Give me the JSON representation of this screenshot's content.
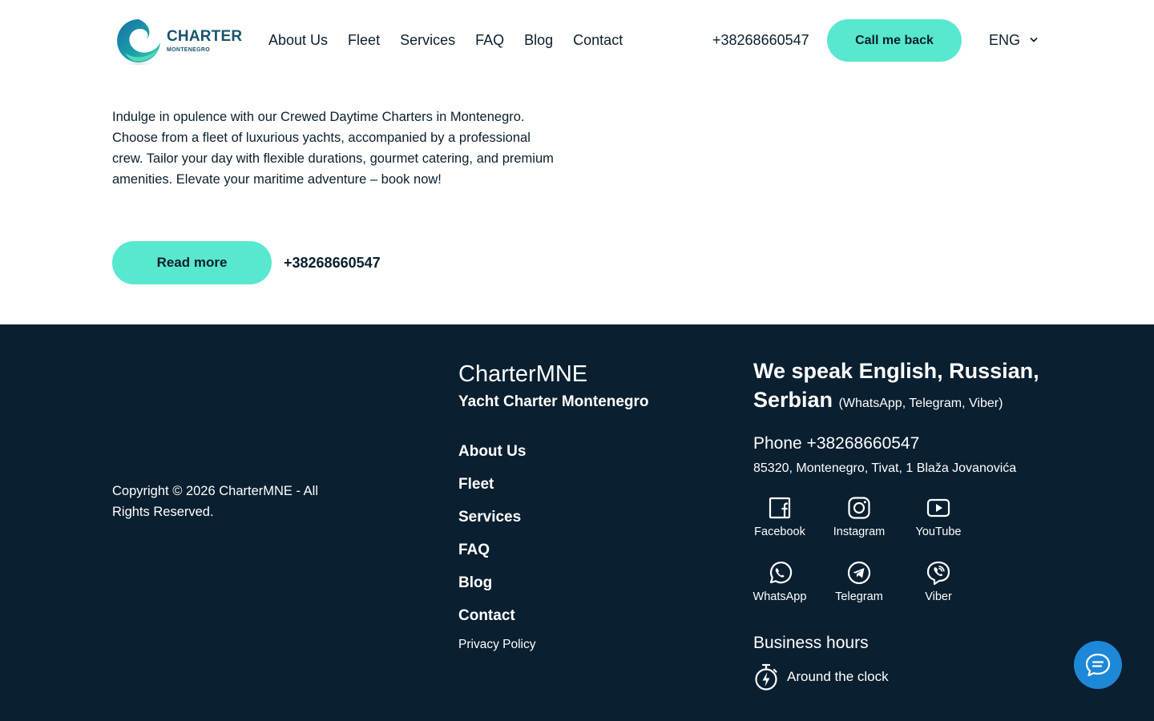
{
  "header": {
    "logo": {
      "title": "CHARTER",
      "subtitle": "MONTENEGRO"
    },
    "nav": [
      "About Us",
      "Fleet",
      "Services",
      "FAQ",
      "Blog",
      "Contact"
    ],
    "phone": "+38268660547",
    "callback_label": "Call me back",
    "language": "ENG"
  },
  "hero": {
    "description": "Indulge in opulence with our Crewed Daytime Charters in Montenegro. Choose from a fleet of luxurious yachts, accompanied by a professional crew. Tailor your day with flexible durations, gourmet catering, and premium amenities. Elevate your maritime adventure – book now!",
    "read_more_label": "Read more",
    "phone": "+38268660547"
  },
  "footer": {
    "copyright": "Copyright © 2026 CharterMNE - All Rights Reserved.",
    "brand_title": "CharterMNE",
    "brand_subtitle": "Yacht Charter Montenegro",
    "nav": [
      "About Us",
      "Fleet",
      "Services",
      "FAQ",
      "Blog",
      "Contact"
    ],
    "privacy": "Privacy Policy",
    "languages_main": "We speak English, Russian, Serbian",
    "languages_note": "(WhatsApp, Telegram, Viber)",
    "phone": "Phone +38268660547",
    "address": "85320, Montenegro, Tivat, 1 Blaža Jovanovića",
    "socials": [
      "Facebook",
      "Instagram",
      "YouTube",
      "WhatsApp",
      "Telegram",
      "Viber"
    ],
    "hours_title": "Business hours",
    "hours_value": "Around the clock"
  },
  "colors": {
    "accent": "#58e8cf",
    "footer_bg": "#0a1f30",
    "brand_text": "#18546d",
    "chat_button": "#1e88d8"
  },
  "icons": {
    "logo": "wave-logo-icon",
    "language": "chevron-down-icon",
    "socials": [
      "facebook-icon",
      "instagram-icon",
      "youtube-icon",
      "whatsapp-icon",
      "telegram-icon",
      "viber-icon"
    ],
    "hours": "stopwatch-icon",
    "chat": "chat-icon"
  }
}
